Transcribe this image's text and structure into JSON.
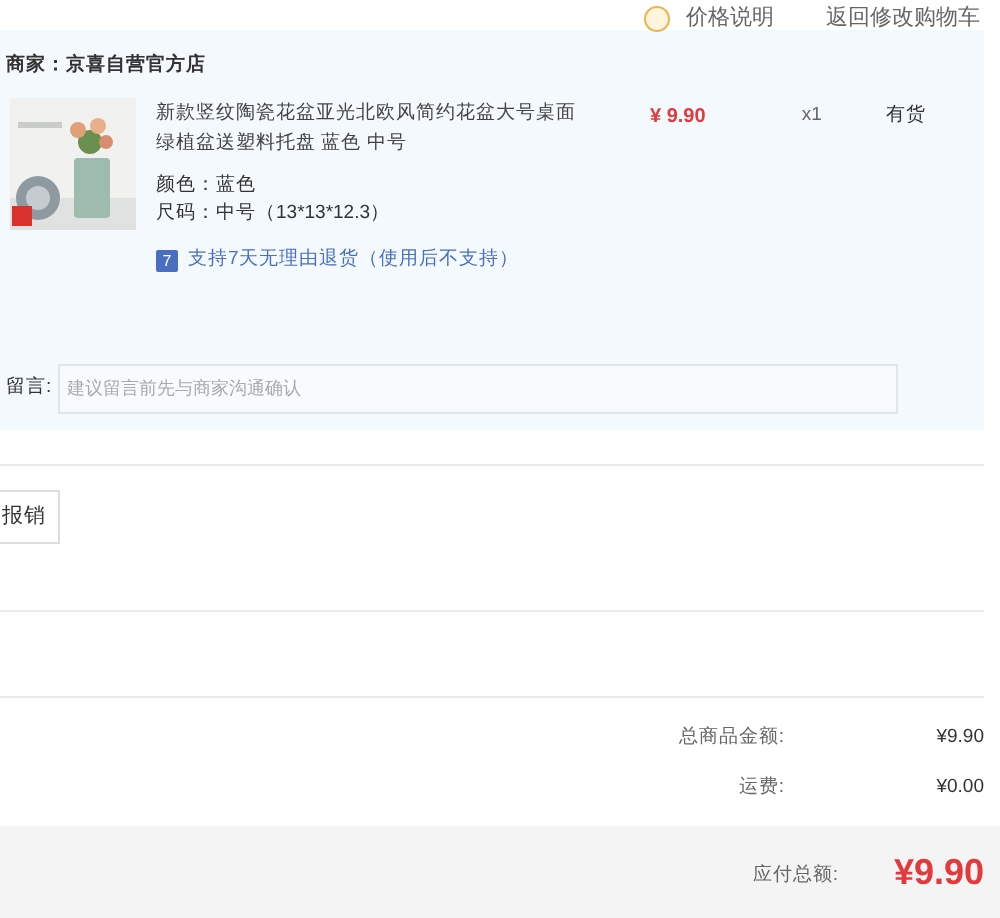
{
  "top_links": [
    {
      "kind": "info",
      "label": "价格说明"
    },
    {
      "kind": "link",
      "label": "返回修改购物车"
    }
  ],
  "seller": {
    "label": "商家：",
    "name": "京喜自营官方店"
  },
  "item": {
    "title": "新款竖纹陶瓷花盆亚光北欧风简约花盆大号桌面绿植盆送塑料托盘 蓝色 中号",
    "price": "¥ 9.90",
    "quantity": "x1",
    "stock": "有货",
    "attributes": [
      {
        "label": "颜色：",
        "value": "蓝色"
      },
      {
        "label": "尺码：",
        "value": "中号（13*13*12.3）"
      }
    ],
    "return_badge": "7",
    "return_policy": "支持7天无理由退货（使用后不支持）"
  },
  "note": {
    "label": "留言:",
    "placeholder": "建议留言前先与商家沟通确认"
  },
  "invoice_button": "报销",
  "summary": [
    {
      "label": "总商品金额:",
      "value": "¥9.90"
    },
    {
      "label": "运费:",
      "value": "¥0.00"
    }
  ],
  "total": {
    "label": "应付总额:",
    "value": "¥9.90"
  }
}
